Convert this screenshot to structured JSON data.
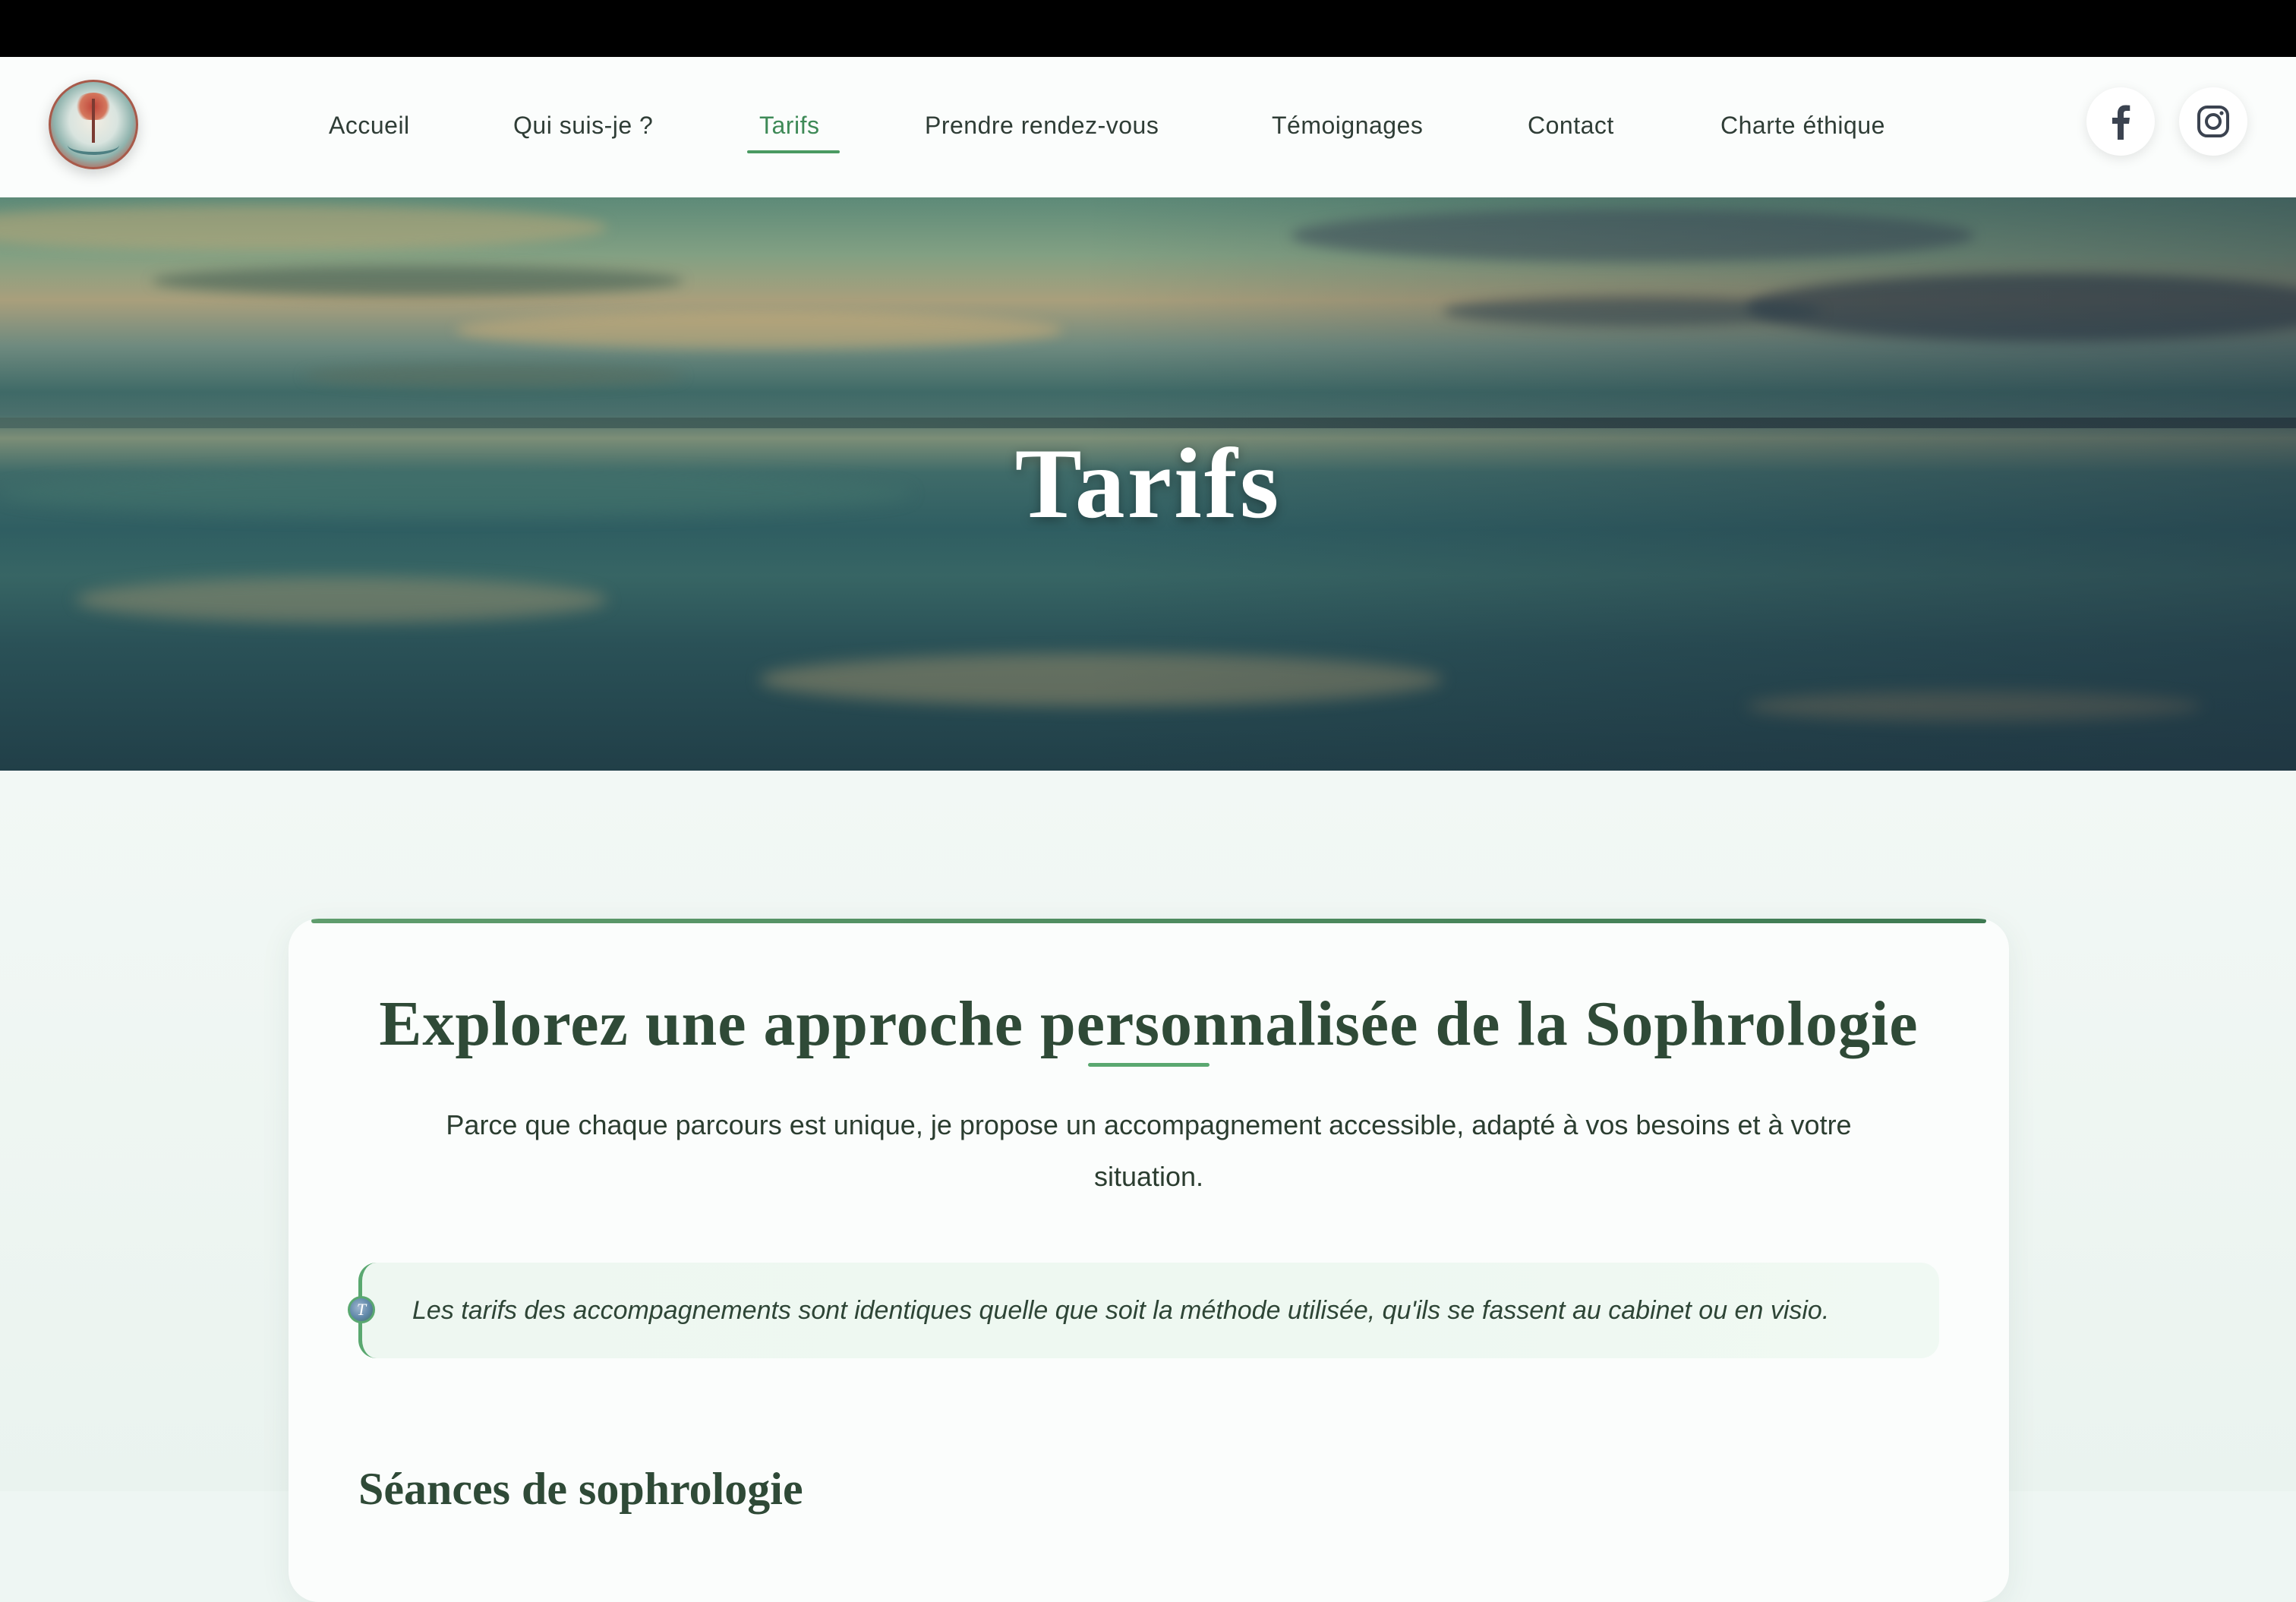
{
  "header": {
    "logo_alt": "Logo",
    "nav": [
      {
        "label": "Accueil",
        "active": false
      },
      {
        "label": "Qui suis-je ?",
        "active": false
      },
      {
        "label": "Tarifs",
        "active": true
      },
      {
        "label": "Prendre rendez-vous",
        "active": false
      },
      {
        "label": "Témoignages",
        "active": false
      },
      {
        "label": "Contact",
        "active": false
      },
      {
        "label": "Charte éthique",
        "active": false
      }
    ],
    "social": [
      {
        "icon": "facebook-icon"
      },
      {
        "icon": "instagram-icon"
      }
    ]
  },
  "hero": {
    "title": "Tarifs"
  },
  "card": {
    "title": "Explorez une approche personnalisée de la Sophrologie",
    "intro_line1": "Parce que chaque parcours est unique, je propose un accompagnement accessible, adapté à vos besoins et à votre",
    "intro_line2": "situation.",
    "note_marker": "T",
    "note": "Les tarifs des accompagnements sont identiques quelle que soit la méthode utilisée, qu'ils se fassent au cabinet ou en visio.",
    "section_title": "Séances de sophrologie"
  },
  "colors": {
    "accent": "#4a9a62",
    "nav_text": "#2f3d36",
    "heading": "#2f4a37"
  }
}
